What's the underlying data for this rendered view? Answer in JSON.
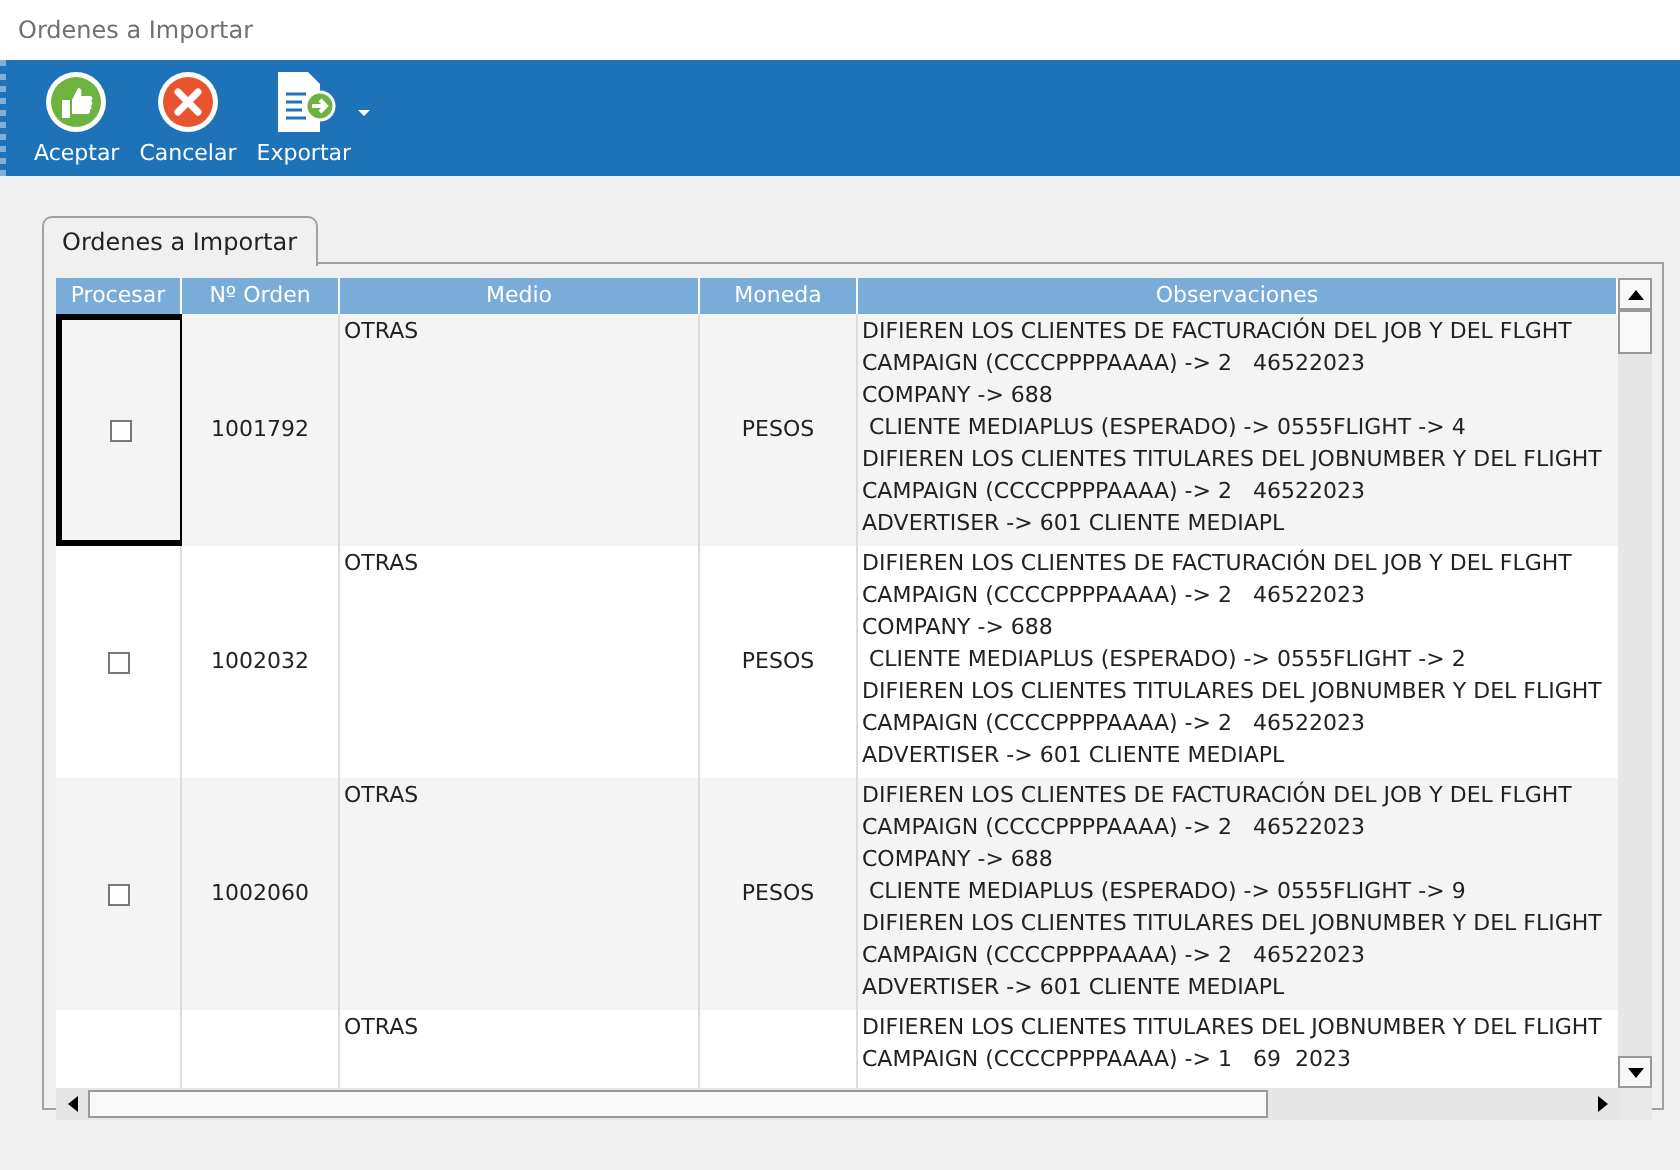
{
  "window": {
    "title": "Ordenes a Importar"
  },
  "toolbar": [
    {
      "label": "Aceptar",
      "kind": "accept"
    },
    {
      "label": "Cancelar",
      "kind": "cancel"
    },
    {
      "label": "Exportar",
      "kind": "export",
      "dropdown": true
    }
  ],
  "tabs": [
    {
      "label": "Ordenes a Importar",
      "selected": true
    }
  ],
  "table": {
    "columns": [
      "Procesar",
      "Nº Orden",
      "Medio",
      "Moneda",
      "Observaciones"
    ],
    "rows": [
      {
        "checked": false,
        "focused": true,
        "order": "1001792",
        "medio": "OTRAS",
        "moneda": "PESOS",
        "observaciones": [
          "DIFIEREN LOS CLIENTES DE FACTURACIÓN DEL JOB Y DEL FLGHT",
          "CAMPAIGN (CCCCPPPPAAAA) -> 2   46522023",
          "COMPANY -> 688",
          " CLIENTE MEDIAPLUS (ESPERADO) -> 0555FLIGHT -> 4",
          "DIFIEREN LOS CLIENTES TITULARES DEL JOBNUMBER Y DEL FLIGHT",
          "CAMPAIGN (CCCCPPPPAAAA) -> 2   46522023",
          "ADVERTISER -> 601 CLIENTE MEDIAPL"
        ]
      },
      {
        "checked": false,
        "focused": false,
        "order": "1002032",
        "medio": "OTRAS",
        "moneda": "PESOS",
        "observaciones": [
          "DIFIEREN LOS CLIENTES DE FACTURACIÓN DEL JOB Y DEL FLGHT",
          "CAMPAIGN (CCCCPPPPAAAA) -> 2   46522023",
          "COMPANY -> 688",
          " CLIENTE MEDIAPLUS (ESPERADO) -> 0555FLIGHT -> 2",
          "DIFIEREN LOS CLIENTES TITULARES DEL JOBNUMBER Y DEL FLIGHT",
          "CAMPAIGN (CCCCPPPPAAAA) -> 2   46522023",
          "ADVERTISER -> 601 CLIENTE MEDIAPL"
        ]
      },
      {
        "checked": false,
        "focused": false,
        "order": "1002060",
        "medio": "OTRAS",
        "moneda": "PESOS",
        "observaciones": [
          "DIFIEREN LOS CLIENTES DE FACTURACIÓN DEL JOB Y DEL FLGHT",
          "CAMPAIGN (CCCCPPPPAAAA) -> 2   46522023",
          "COMPANY -> 688",
          " CLIENTE MEDIAPLUS (ESPERADO) -> 0555FLIGHT -> 9",
          "DIFIEREN LOS CLIENTES TITULARES DEL JOBNUMBER Y DEL FLIGHT",
          "CAMPAIGN (CCCCPPPPAAAA) -> 2   46522023",
          "ADVERTISER -> 601 CLIENTE MEDIAPL"
        ]
      },
      {
        "medio": "OTRAS",
        "observaciones": [
          "DIFIEREN LOS CLIENTES TITULARES DEL JOBNUMBER Y DEL FLIGHT",
          "CAMPAIGN (CCCCPPPPAAAA) -> 1   69  2023"
        ]
      }
    ]
  }
}
